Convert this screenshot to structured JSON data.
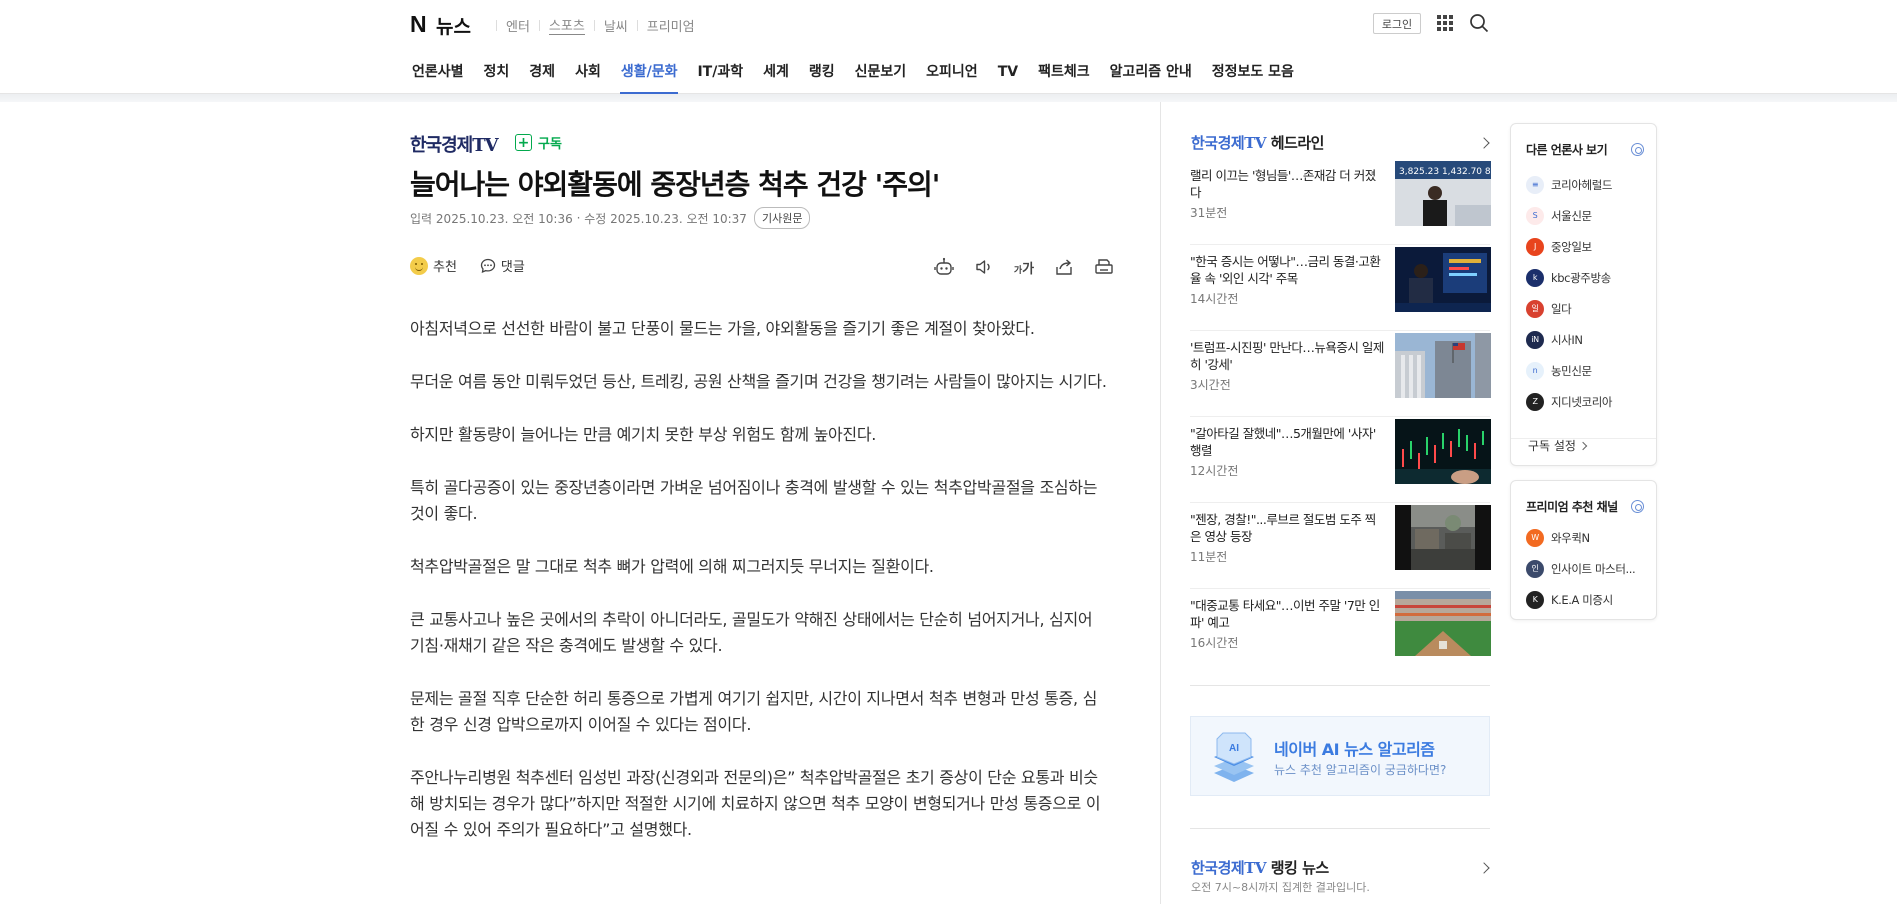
{
  "header": {
    "logo_n": "N",
    "logo_news": "뉴스",
    "services": [
      "엔터",
      "스포츠",
      "날씨",
      "프리미엄"
    ],
    "login_label": "로그인"
  },
  "nav": {
    "items": [
      "언론사별",
      "정치",
      "경제",
      "사회",
      "생활/문화",
      "IT/과학",
      "세계",
      "랭킹",
      "신문보기",
      "오피니언",
      "TV",
      "팩트체크",
      "알고리즘 안내",
      "정정보도 모음"
    ],
    "active_index": 4,
    "accent_color": "#3b6bd0"
  },
  "article": {
    "press": "한국경제TV",
    "subscribe_label": "구독",
    "headline": "늘어나는 야외활동에 중장년층 척추 건강 '주의'",
    "input_label": "입력",
    "input_time": "2025.10.23. 오전 10:36",
    "modified_label": "수정",
    "modified_time": "2025.10.23. 오전 10:37",
    "original_label": "기사원문",
    "recommend_label": "추천",
    "comment_label": "댓글",
    "font_size_label": "가",
    "paragraphs": [
      "아침저녁으로 선선한 바람이 불고 단풍이 물드는 가을, 야외활동을 즐기기 좋은 계절이 찾아왔다.",
      "무더운 여름 동안 미뤄두었던 등산, 트레킹, 공원 산책을 즐기며 건강을 챙기려는 사람들이 많아지는 시기다.",
      "하지만 활동량이 늘어나는 만큼 예기치 못한 부상 위험도 함께 높아진다.",
      "특히 골다공증이 있는 중장년층이라면 가벼운 넘어짐이나 충격에 발생할 수 있는 척추압박골절을 조심하는 것이 좋다.",
      "척추압박골절은 말 그대로 척추 뼈가 압력에 의해 찌그러지듯 무너지는 질환이다.",
      "큰 교통사고나 높은 곳에서의 추락이 아니더라도, 골밀도가 약해진 상태에서는 단순히 넘어지거나, 심지어 기침·재채기 같은 작은 충격에도 발생할 수 있다.",
      "문제는 골절 직후 단순한 허리 통증으로 가볍게 여기기 쉽지만, 시간이 지나면서 척추 변형과 만성 통증, 심한 경우 신경 압박으로까지 이어질 수 있다는 점이다.",
      "주안나누리병원 척추센터 임성빈 과장(신경외과 전문의)은” 척추압박골절은 초기 증상이 단순 요통과 비슷해 방치되는 경우가 많다”하지만 적절한 시기에 치료하지 않으면 척추 모양이 변형되거나 만성 통증으로 이어질 수 있어 주의가 필요하다”고 설명했다."
    ]
  },
  "headlines": {
    "brand": "한국경제TV",
    "title": "헤드라인",
    "items": [
      {
        "text": "랠리 이끄는 '형님들'…존재감 더 커졌다",
        "ago": "31분전",
        "thumb": "studio"
      },
      {
        "text": "\"한국 증시는 어떻나\"…금리 동결·고환율 속 '외인 시각' 주목",
        "ago": "14시간전",
        "thumb": "broadcast"
      },
      {
        "text": "'트럼프-시진핑' 만난다…뉴욕증시 일제히 '강세'",
        "ago": "3시간전",
        "thumb": "building"
      },
      {
        "text": "\"갈아타길 잘했네\"…5개월만에 '사자' 행렬",
        "ago": "12시간전",
        "thumb": "chart"
      },
      {
        "text": "\"젠장, 경찰!\"...루브르 절도범 도주 찍은 영상 등장",
        "ago": "11분전",
        "thumb": "street"
      },
      {
        "text": "\"대중교통 타세요\"…이번 주말 '7만 인파' 예고",
        "ago": "16시간전",
        "thumb": "stadium"
      }
    ]
  },
  "ai_banner": {
    "main": "네이버 AI 뉴스 알고리즘",
    "sub": "뉴스 추천 알고리즘이 궁금하다면?",
    "badge": "AI"
  },
  "ranking": {
    "brand": "한국경제TV",
    "title": "랭킹 뉴스",
    "sub": "오전 7시~8시까지 집계한 결과입니다."
  },
  "other_press": {
    "title": "다른 언론사 보기",
    "items": [
      {
        "name": "코리아헤럴드",
        "color": "#e8eef8",
        "glyph": "≡"
      },
      {
        "name": "서울신문",
        "color": "#fdeaea",
        "glyph": "S"
      },
      {
        "name": "중앙일보",
        "color": "#e8441d",
        "glyph": "J"
      },
      {
        "name": "kbc광주방송",
        "color": "#1b2f6b",
        "glyph": "k"
      },
      {
        "name": "일다",
        "color": "#d8412f",
        "glyph": "일"
      },
      {
        "name": "시사IN",
        "color": "#1e2a4f",
        "glyph": "iN"
      },
      {
        "name": "농민신문",
        "color": "#e6f1fb",
        "glyph": "n"
      },
      {
        "name": "지디넷코리아",
        "color": "#222222",
        "glyph": "Z"
      }
    ],
    "footer": "구독 설정"
  },
  "premium": {
    "title": "프리미엄 추천 채널",
    "items": [
      {
        "name": "와우퀵N",
        "color": "#f26a21",
        "glyph": "W"
      },
      {
        "name": "인사이트 마스터...",
        "color": "#3b4a6b",
        "glyph": "인"
      },
      {
        "name": "K.E.A 미증시",
        "color": "#222222",
        "glyph": "K"
      }
    ]
  }
}
